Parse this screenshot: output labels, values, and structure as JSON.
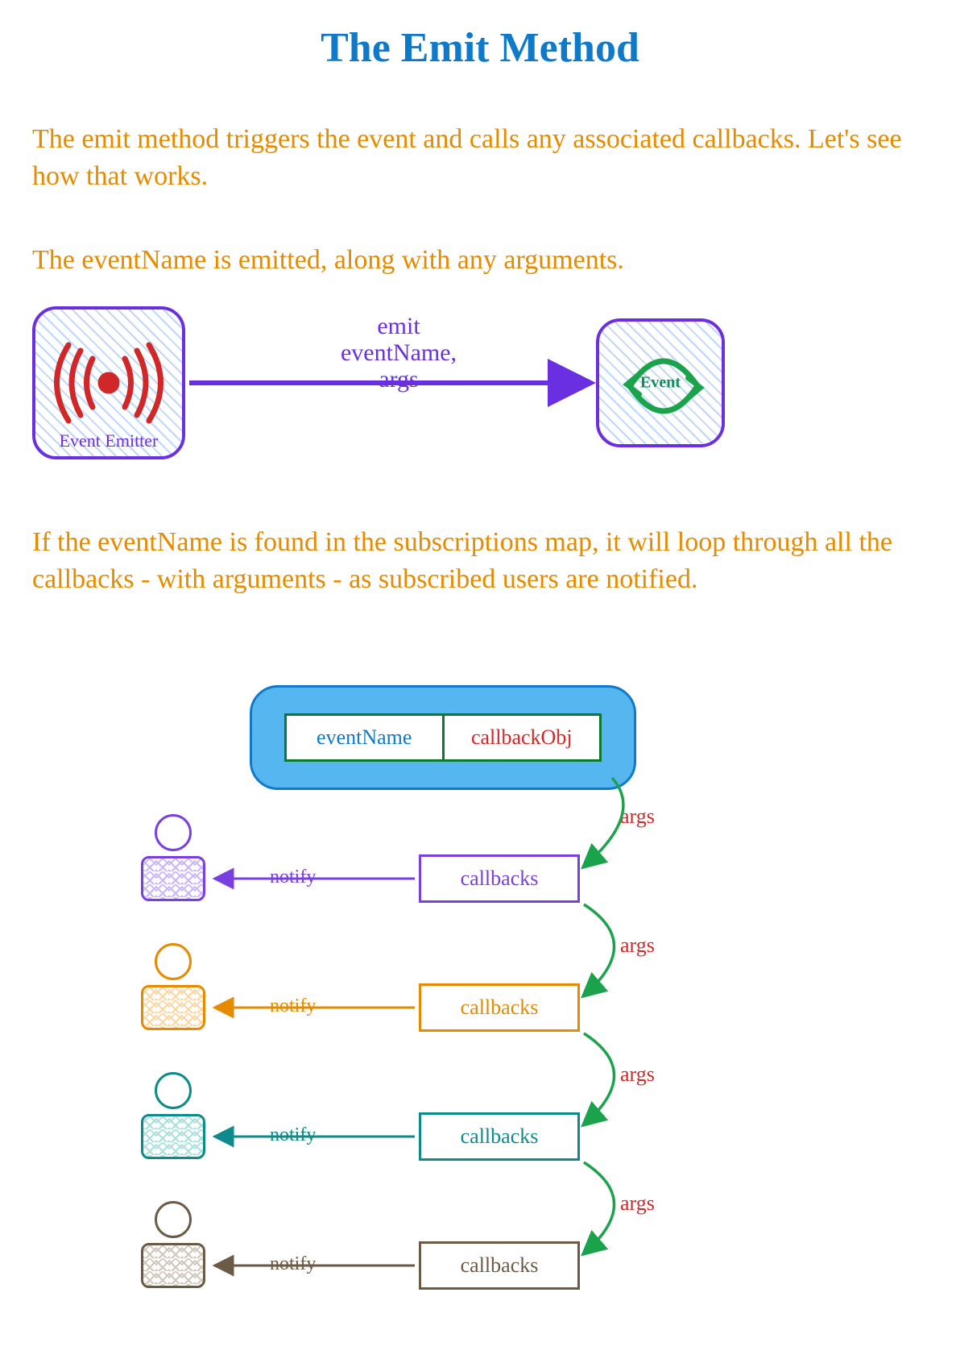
{
  "title": "The Emit Method",
  "para1": "The emit method triggers the event and calls any associated callbacks. Let's see how that works.",
  "para2": "The eventName is emitted, along with any arguments.",
  "para3": "If the eventName is found in the subscriptions map, it will loop through all the callbacks - with arguments - as subscribed users are notified.",
  "emitter": {
    "label": "Event Emitter"
  },
  "emit_arrow": {
    "line1": "emit",
    "line2": "eventName,",
    "line3": "args"
  },
  "event_box": {
    "label": "Event"
  },
  "subscriptions": {
    "left": "eventName",
    "right": "callbackObj"
  },
  "rows": [
    {
      "color": "#7a3fe0",
      "cb": "callbacks",
      "args": "args",
      "notify": "notify"
    },
    {
      "color": "#e68a00",
      "cb": "callbacks",
      "args": "args",
      "notify": "notify"
    },
    {
      "color": "#0d8a8a",
      "cb": "callbacks",
      "args": "args",
      "notify": "notify"
    },
    {
      "color": "#6b5a45",
      "cb": "callbacks",
      "args": "args",
      "notify": "notify"
    }
  ]
}
